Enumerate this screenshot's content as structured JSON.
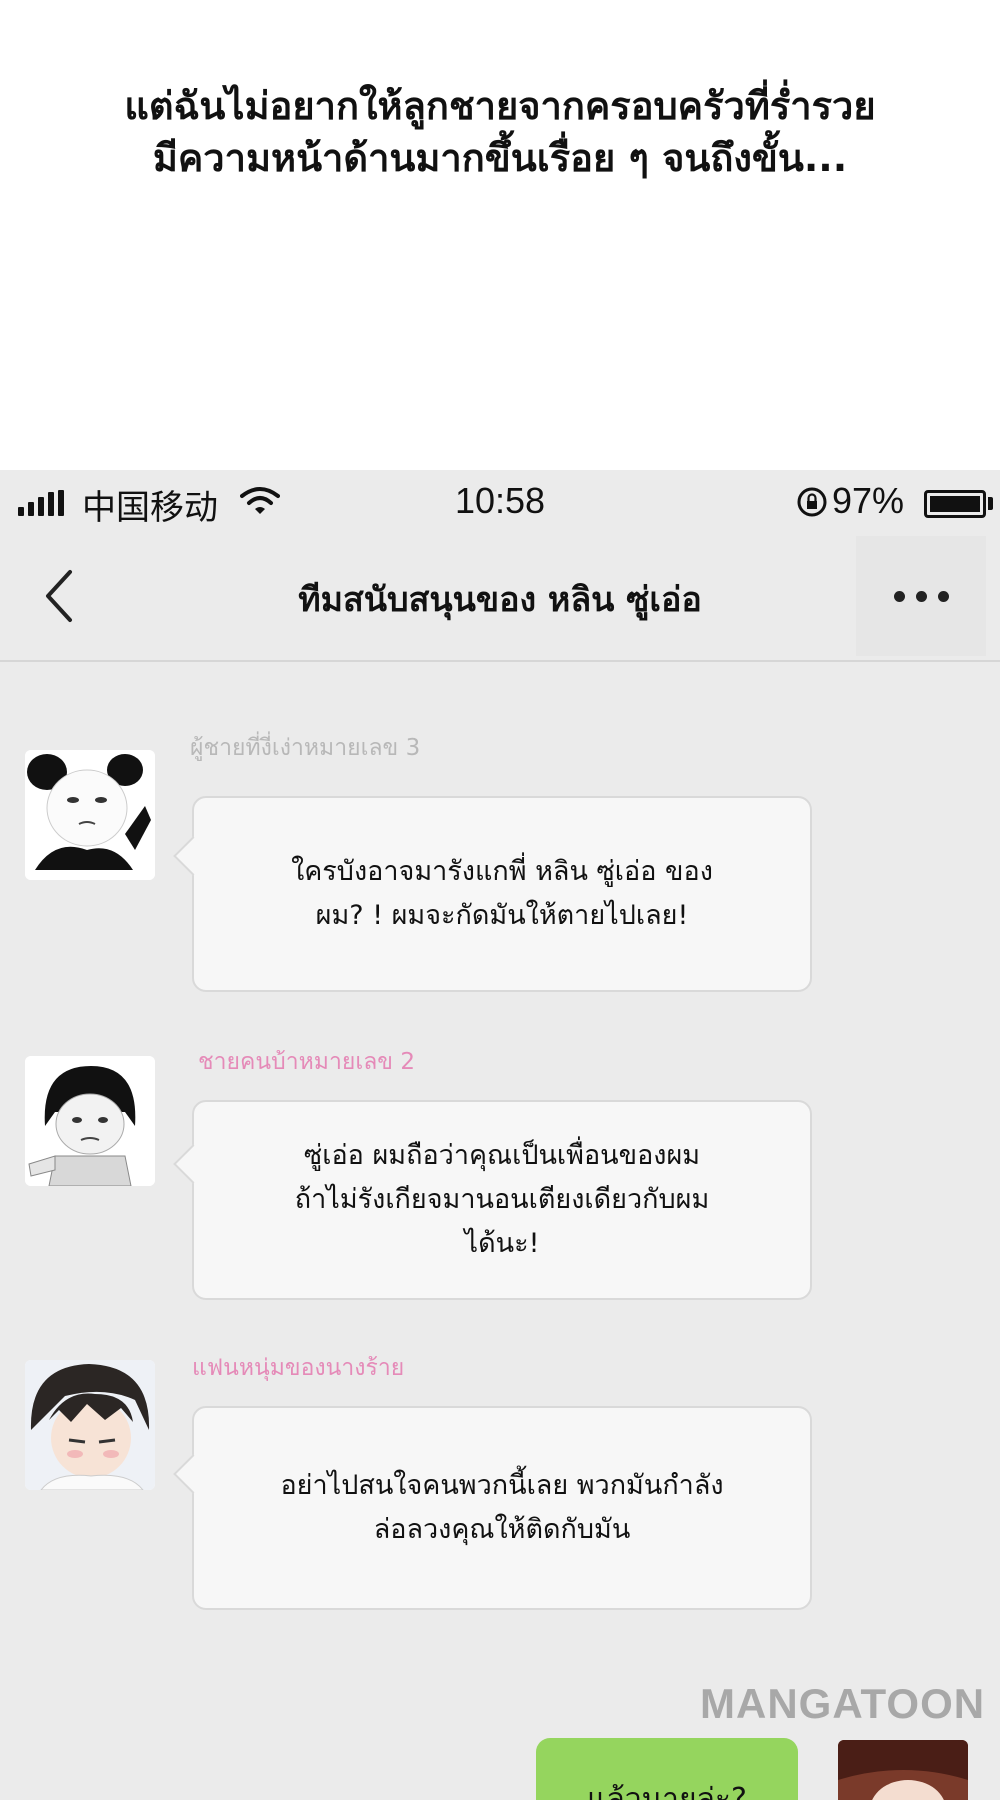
{
  "narration": {
    "line1": "แต่ฉันไม่อยากให้ลูกชายจากครอบครัวที่ร่ำรวย",
    "line2": "มีความหน้าด้านมากขึ้นเรื่อย ๆ จนถึงขั้น..."
  },
  "status_bar": {
    "carrier": "中国移动",
    "time": "10:58",
    "battery": "97%"
  },
  "nav": {
    "title": "ทีมสนับสนุนของ หลิน ซู่เอ่อ"
  },
  "messages": [
    {
      "sender": "ผู้ชายที่งี่เง่าหมายเลข 3",
      "sender_color": "#b8b8b8",
      "lines": [
        "ใครบังอาจมารังแกพี่ หลิน ซู่เอ่อ ของ",
        "ผม? ! ผมจะกัดมันให้ตายไปเลย!"
      ]
    },
    {
      "sender": "ชายคนบ้าหมายเลข 2",
      "sender_color": "#e58ab8",
      "lines": [
        "ซู่เอ่อ ผมถือว่าคุณเป็นเพื่อนของผม",
        "ถ้าไม่รังเกียจมานอนเตียงเดียวกับผม",
        "ได้นะ!"
      ]
    },
    {
      "sender": "แฟนหนุ่มของนางร้าย",
      "sender_color": "#e58ab8",
      "lines": [
        "อย่าไปสนใจคนพวกนี้เลย พวกมันกำลัง",
        "ล่อลวงคุณให้ติดกับมัน"
      ]
    }
  ],
  "outgoing": {
    "text": "แล้วนายล่ะ?"
  },
  "watermark": "MANGATOON"
}
